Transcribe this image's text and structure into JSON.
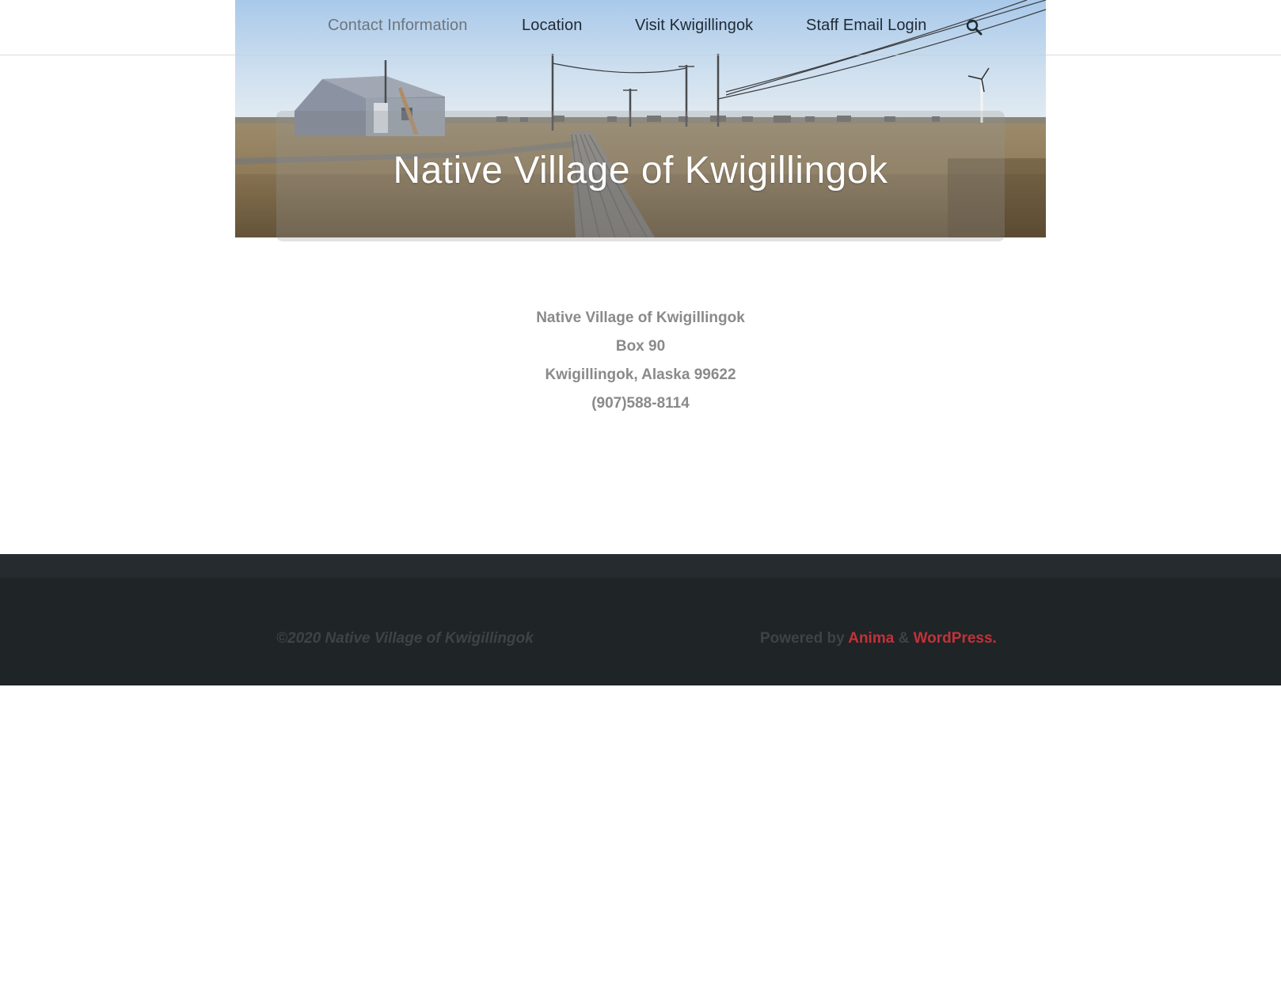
{
  "nav": {
    "items": [
      {
        "label": "Contact Information",
        "active": true
      },
      {
        "label": "Location",
        "active": false
      },
      {
        "label": "Visit Kwigillingok",
        "active": false
      },
      {
        "label": "Staff Email Login",
        "active": false
      }
    ],
    "search_icon": "search-icon"
  },
  "hero": {
    "title": "Native Village of Kwigillingok"
  },
  "contact": {
    "name": "Native Village of Kwigillingok",
    "box": "Box 90",
    "city": "Kwigillingok, Alaska  99622",
    "phone": "(907)588-8114"
  },
  "footer": {
    "copyright": "©2020 Native Village of Kwigillingok",
    "powered_prefix": "Powered by ",
    "link1": "Anima",
    "amp": " & ",
    "link2": "WordPress",
    "period": "."
  },
  "colors": {
    "link": "#c2323a",
    "footer_bg": "#1f2426",
    "contact_text": "#8a8a8a"
  }
}
